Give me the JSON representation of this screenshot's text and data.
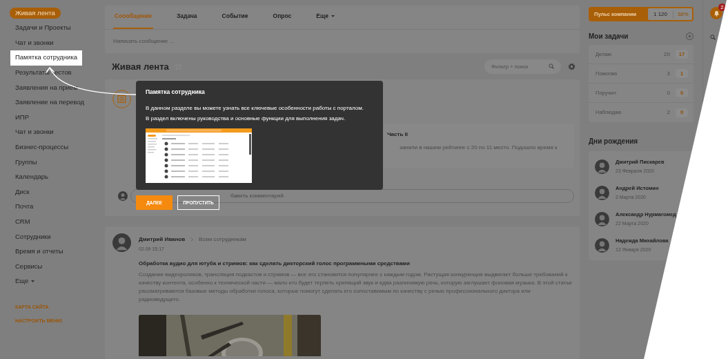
{
  "sidebar": {
    "items": [
      {
        "label": "Живая лента",
        "selected": true,
        "spotlight": false,
        "caret": false
      },
      {
        "label": "Задачи и Проекты",
        "selected": false,
        "spotlight": false,
        "caret": false
      },
      {
        "label": "Чат и звонки",
        "selected": false,
        "spotlight": false,
        "caret": false
      },
      {
        "label": "Памятка сотрудника",
        "selected": false,
        "spotlight": true,
        "caret": false
      },
      {
        "label": "Результаты тестов",
        "selected": false,
        "spotlight": false,
        "caret": false
      },
      {
        "label": "Заявления на прием",
        "selected": false,
        "spotlight": false,
        "caret": false
      },
      {
        "label": "Заявление на перевод",
        "selected": false,
        "spotlight": false,
        "caret": false
      },
      {
        "label": "ИПР",
        "selected": false,
        "spotlight": false,
        "caret": false
      },
      {
        "label": "Чат и звонки",
        "selected": false,
        "spotlight": false,
        "caret": false
      },
      {
        "label": "Бизнес-процессы",
        "selected": false,
        "spotlight": false,
        "caret": false
      },
      {
        "label": "Группы",
        "selected": false,
        "spotlight": false,
        "caret": false
      },
      {
        "label": "Календарь",
        "selected": false,
        "spotlight": false,
        "caret": false
      },
      {
        "label": "Диск",
        "selected": false,
        "spotlight": false,
        "caret": false
      },
      {
        "label": "Почта",
        "selected": false,
        "spotlight": false,
        "caret": false
      },
      {
        "label": "CRM",
        "selected": false,
        "spotlight": false,
        "caret": false
      },
      {
        "label": "Сотрудники",
        "selected": false,
        "spotlight": false,
        "caret": false
      },
      {
        "label": "Время и отчеты",
        "selected": false,
        "spotlight": false,
        "caret": false
      },
      {
        "label": "Сервисы",
        "selected": false,
        "spotlight": false,
        "caret": false
      },
      {
        "label": "Еще",
        "selected": false,
        "spotlight": false,
        "caret": true
      }
    ],
    "footer_links": [
      "КАРТА САЙТА",
      "НАСТРОИТЬ МЕНЮ"
    ]
  },
  "composer": {
    "tabs": [
      {
        "label": "Соообщение",
        "selected": true,
        "caret": false
      },
      {
        "label": "Задача",
        "selected": false,
        "caret": false
      },
      {
        "label": "Событие",
        "selected": false,
        "caret": false
      },
      {
        "label": "Опрос",
        "selected": false,
        "caret": false
      },
      {
        "label": "Еще",
        "selected": false,
        "caret": true
      }
    ],
    "placeholder": "Написать сообщение ..."
  },
  "feed": {
    "title": "Живая лента",
    "filter_placeholder": "Фильтр + поиск"
  },
  "posts": [
    {
      "kind": "news",
      "title": "Часть II",
      "body": [
        "заняли в нашем рейтинге с 20 по 11 место. Подошло время к"
      ],
      "comment_placeholder": "бавить комментарий"
    },
    {
      "kind": "user",
      "author": "Дмитрий Иванов",
      "audience": "Всем сотрудникам",
      "time": "02.09 15:17",
      "title": "Обработка аудио для ютуба и стримов: как сделать дикторский голос программными средствами",
      "body": [
        "Создание видеороликов, трансляция подкастов и стримов — все это становится популярнее с каждым годом. Растущая конкуренция выдвигает больше требований к качеству контента, особенно к технической части — мало кто будет терпеть хрипящий звук и едва различимую речь, которую заглушает фоновая музыка. В этой статье рассматриваются базовые методы обработки голоса, которые помогут сделать его сопоставимым по качеству с речью профессионального диктора или радиоведущего."
      ],
      "picture": {
        "kind": "picture"
      }
    }
  ],
  "pulse": {
    "label": "Пульс компании",
    "value": "1 120",
    "percent": "38%"
  },
  "tasks": {
    "title": "Мои задачи",
    "rows": [
      {
        "label": "Делаю",
        "total": "20",
        "count": "17"
      },
      {
        "label": "Помогаю",
        "total": "3",
        "count": "1"
      },
      {
        "label": "Поручил",
        "total": "0",
        "count": "0"
      },
      {
        "label": "Наблюдаю",
        "total": "2",
        "count": "0"
      }
    ]
  },
  "birthdays": {
    "title": "Дни рождения",
    "people": [
      {
        "name": "Дмитрий Пискарев",
        "date": "23 Февраля 2020"
      },
      {
        "name": "Андрей Истомин",
        "date": "2 Марта 2020"
      },
      {
        "name": "Александр Нурмагомед",
        "date": "22 Марта 2020"
      },
      {
        "name": "Надежда Михайлова",
        "date": "12 Января 2020"
      }
    ]
  },
  "notifications": {
    "count": "2"
  },
  "tour": {
    "title": "Памятка сотрудника",
    "lines": [
      "В данном разделе вы можете узнать все ключевые особенности работы с порталом.",
      "В раздел включены руководства и основные функции для выполнения задач."
    ],
    "buttons": [
      {
        "label": "ДАЛЕЕ",
        "kind": "primary"
      },
      {
        "label": "ПРОПУСТИТЬ",
        "kind": "secondary"
      }
    ]
  }
}
